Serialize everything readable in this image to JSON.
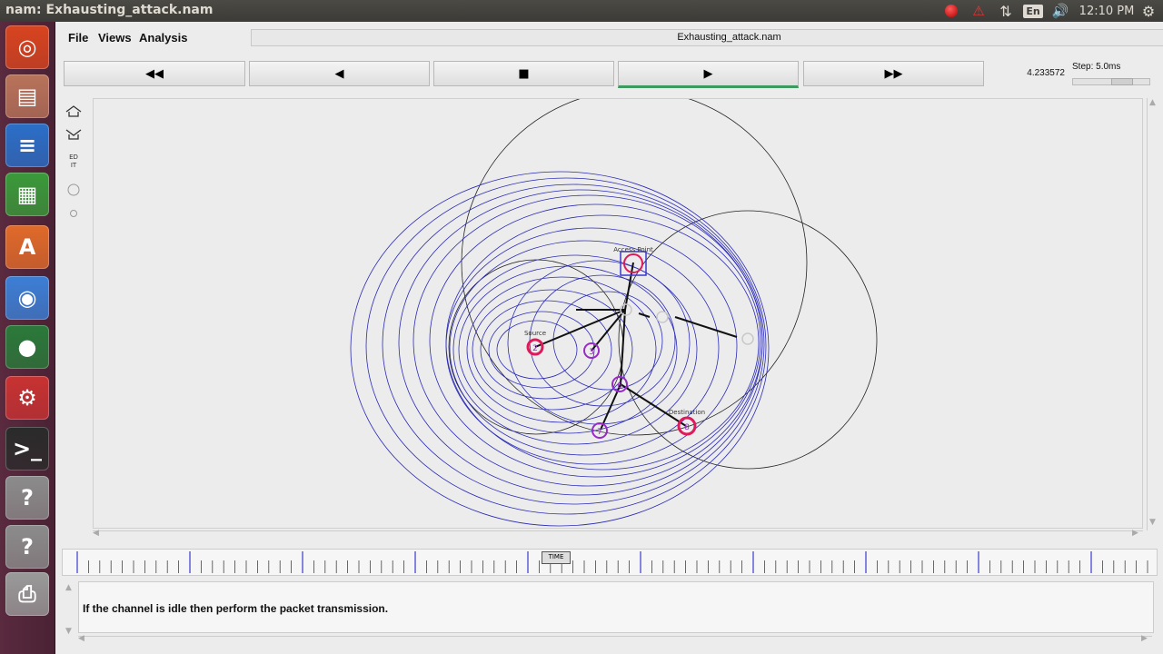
{
  "panel": {
    "window_title": "nam: Exhausting_attack.nam",
    "language": "En",
    "clock": "12:10 PM",
    "icons": [
      "record-indicator-icon",
      "alert-icon",
      "network-icon",
      "keyboard-layout-icon",
      "volume-icon",
      "gear-icon"
    ]
  },
  "launcher": {
    "items": [
      {
        "name": "ubuntu-dash-icon",
        "color": "#d8441f",
        "glyph": "◎"
      },
      {
        "name": "files-icon",
        "color": "#b8735a",
        "glyph": "▤"
      },
      {
        "name": "writer-icon",
        "color": "#2a6fc9",
        "glyph": "≡"
      },
      {
        "name": "calc-icon",
        "color": "#3a9a3a",
        "glyph": "▦"
      },
      {
        "name": "software-center-icon",
        "color": "#e06a2a",
        "glyph": "A"
      },
      {
        "name": "chromium-icon",
        "color": "#3c7fd6",
        "glyph": "◉"
      },
      {
        "name": "globe-icon",
        "color": "#2a7a3a",
        "glyph": "●"
      },
      {
        "name": "settings-icon",
        "color": "#c83232",
        "glyph": "⚙"
      },
      {
        "name": "terminal-icon",
        "color": "#2b2b2b",
        "glyph": ">_"
      },
      {
        "name": "help-icon",
        "color": "#8c8c8c",
        "glyph": "?"
      },
      {
        "name": "help-icon-2",
        "color": "#8c8c8c",
        "glyph": "?"
      },
      {
        "name": "printer-icon",
        "color": "#9a9a9a",
        "glyph": "⎙"
      }
    ]
  },
  "menu": {
    "file": "File",
    "views": "Views",
    "analysis": "Analysis",
    "title": "Exhausting_attack.nam"
  },
  "transport": {
    "rewind": "◀◀",
    "back": "◀",
    "stop": "■",
    "play": "▶",
    "fast_forward": "▶▶",
    "time": "4.233572",
    "step_label": "Step: 5.0ms"
  },
  "tools": {
    "zoom_in_icon": "zoom-in-icon",
    "zoom_out_icon": "zoom-out-icon",
    "edit_label": "ED\nIT"
  },
  "network": {
    "nodes": [
      {
        "id": "2",
        "label": "Source"
      },
      {
        "id": "3",
        "label": ""
      },
      {
        "id": "6",
        "label": ""
      },
      {
        "id": "7",
        "label": ""
      },
      {
        "id": "8",
        "label": "Destination"
      },
      {
        "id": "",
        "label": "Access Point"
      }
    ],
    "colors": {
      "range_circle": "#2b2bb8",
      "range_circle_dark": "#222222",
      "node_ring": "#9a2ac8",
      "highlight": "#e0195a"
    }
  },
  "timeline": {
    "marker_label": "TIME"
  },
  "annotation": {
    "text": "If the channel is idle then perform the packet transmission."
  }
}
